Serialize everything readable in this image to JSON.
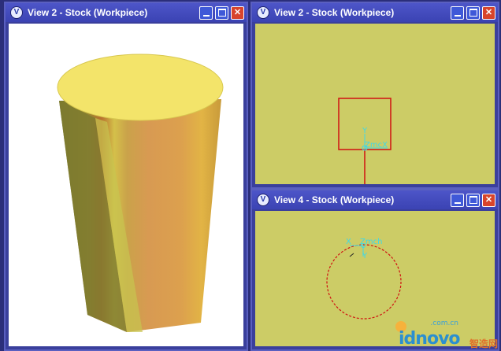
{
  "windows": {
    "left": {
      "title": "View 2 - Stock (Workpiece)"
    },
    "top_right": {
      "title": "View 2 - Stock (Workpiece)",
      "axis": {
        "y": "Y",
        "origin": "ZmcX"
      }
    },
    "bottom_right": {
      "title": "View 4 - Stock (Workpiece)",
      "axis": {
        "x": "X",
        "origin": "Zmch",
        "y": "Y"
      }
    }
  },
  "title_icon": "V",
  "controls": {
    "minimize": "minimize-icon",
    "maximize": "maximize-icon",
    "close": "close-icon",
    "close_glyph": "✕"
  },
  "colors": {
    "viewport_bg": "#cccc66",
    "outline_red": "#d01010",
    "axis_cyan": "#3fd8e8",
    "stock_top": "#f3e46a",
    "titlebar": "#4d55c8"
  },
  "watermark": {
    "top": ".com.cn",
    "brand": "idnovo",
    "cn": "智造网"
  }
}
